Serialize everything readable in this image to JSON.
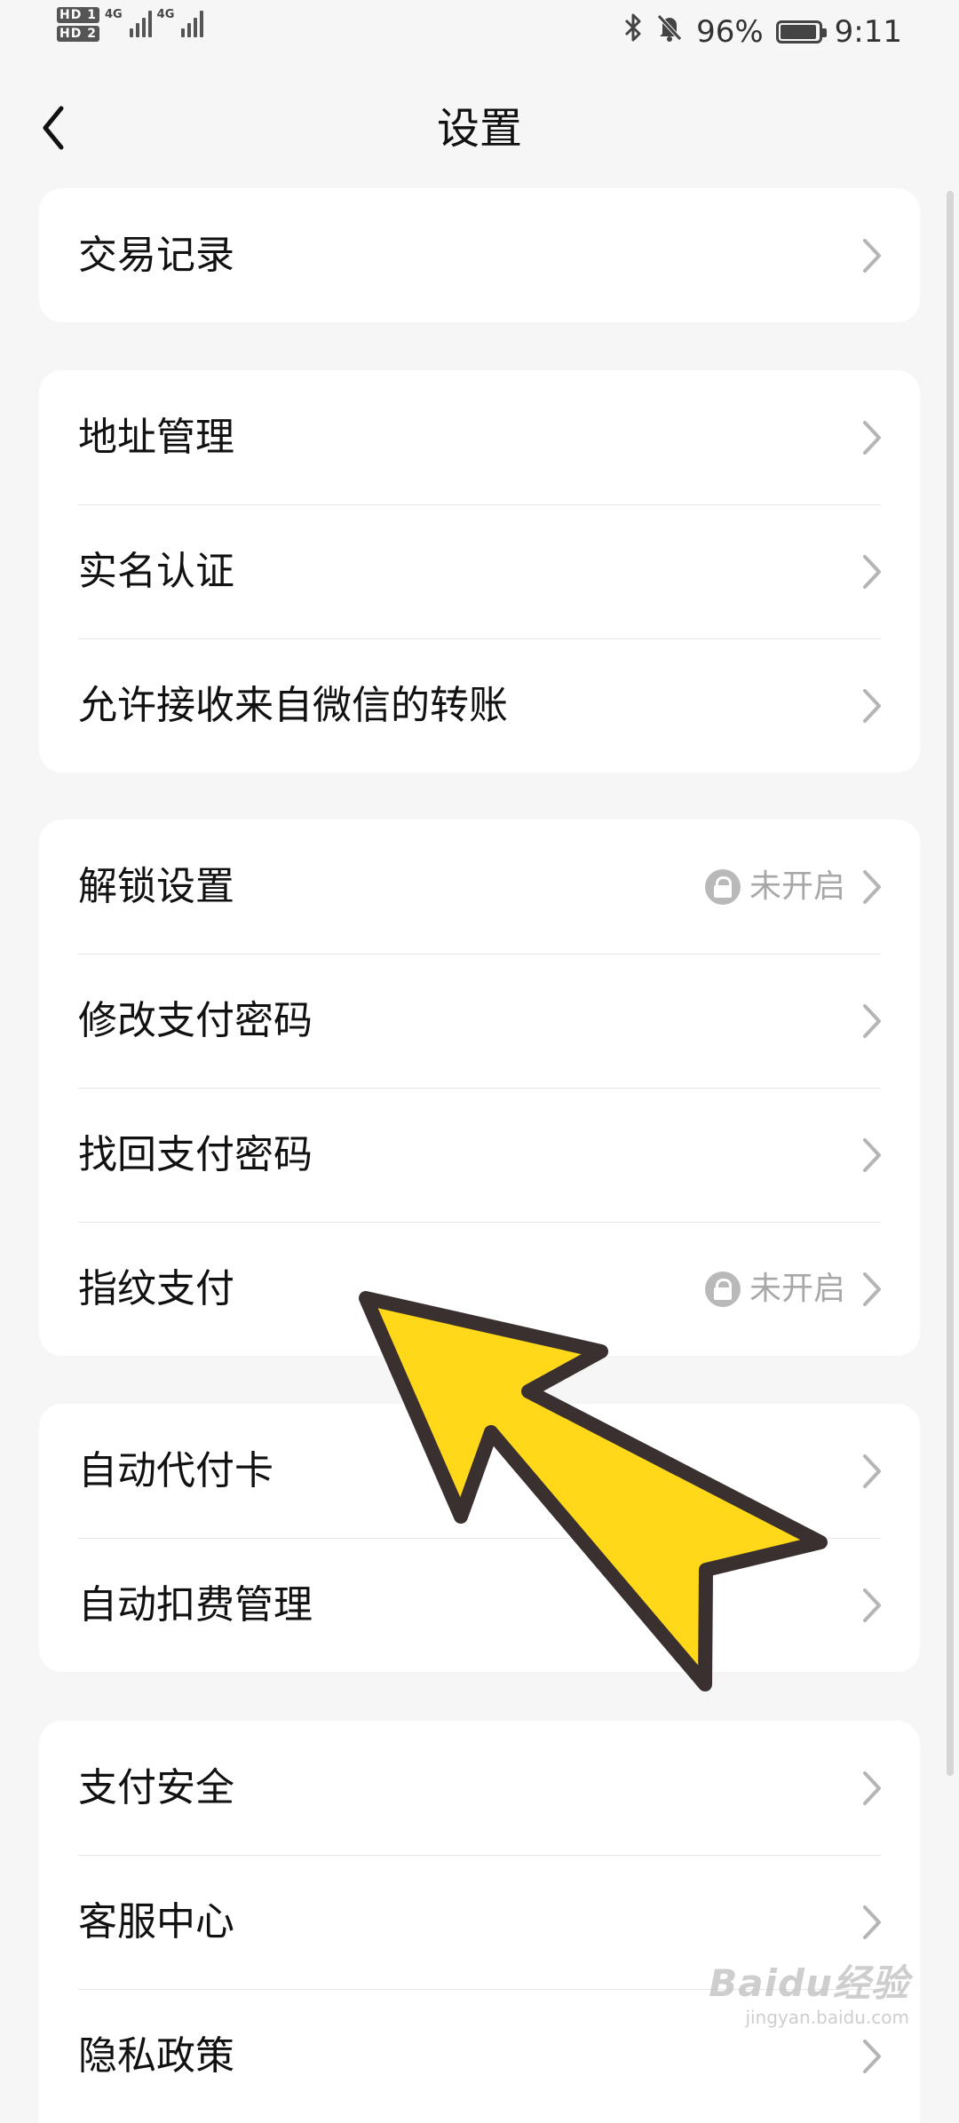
{
  "status_bar": {
    "sim1": "HD 1",
    "sim2": "HD 2",
    "net1": "4G",
    "net2": "4G",
    "bluetooth_icon": "bluetooth-icon",
    "mute_icon": "bell-off-icon",
    "battery_percent": "96%",
    "battery_level": 0.96,
    "time": "9:11"
  },
  "nav": {
    "title": "设置",
    "back_icon": "chevron-left-icon"
  },
  "sections": [
    {
      "items": [
        {
          "label": "交易记录"
        }
      ]
    },
    {
      "items": [
        {
          "label": "地址管理"
        },
        {
          "label": "实名认证"
        },
        {
          "label": "允许接收来自微信的转账"
        }
      ]
    },
    {
      "items": [
        {
          "label": "解锁设置",
          "status": "未开启",
          "status_icon": "lock-icon"
        },
        {
          "label": "修改支付密码"
        },
        {
          "label": "找回支付密码"
        },
        {
          "label": "指纹支付",
          "status": "未开启",
          "status_icon": "lock-icon"
        }
      ]
    },
    {
      "items": [
        {
          "label": "自动代付卡"
        },
        {
          "label": "自动扣费管理"
        }
      ]
    },
    {
      "items": [
        {
          "label": "支付安全"
        },
        {
          "label": "客服中心"
        },
        {
          "label": "隐私政策"
        }
      ]
    }
  ],
  "annotation": {
    "type": "arrow",
    "color": "#FFD919",
    "outline_color": "#3a3030",
    "points_to": "指纹支付"
  },
  "watermark": {
    "logo": "Baidu经验",
    "url": "jingyan.baidu.com"
  },
  "colors": {
    "background": "#f6f6f6",
    "card": "#ffffff",
    "text": "#111111",
    "muted": "#a8a8a8",
    "chevron": "#b5b5b5"
  }
}
